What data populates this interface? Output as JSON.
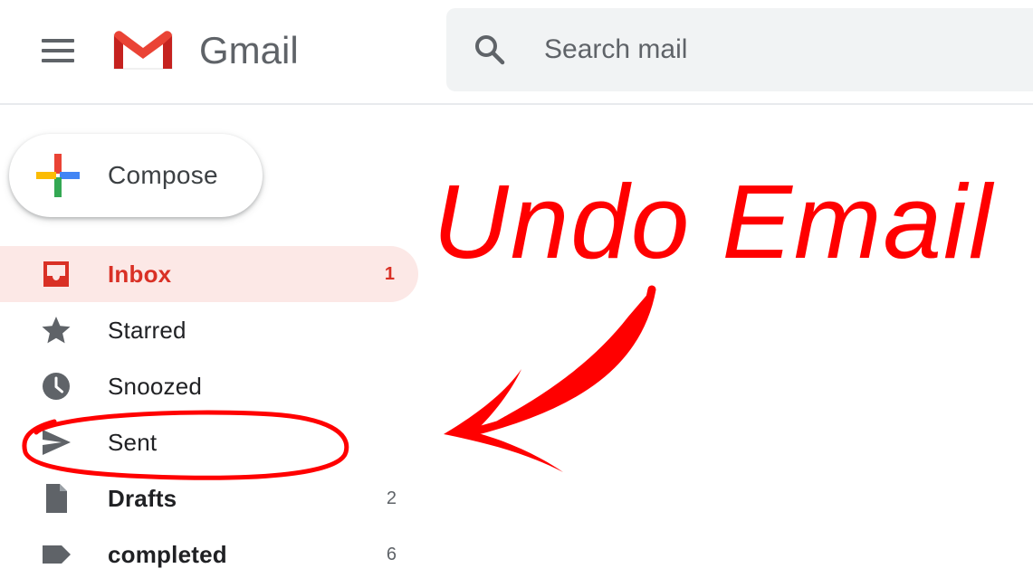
{
  "header": {
    "app_name": "Gmail",
    "menu_icon": "hamburger-menu-icon",
    "logo_icon": "gmail-m-logo-icon"
  },
  "search": {
    "placeholder": "Search mail",
    "value": "",
    "icon": "search-icon"
  },
  "compose": {
    "label": "Compose",
    "icon": "colorful-plus-icon"
  },
  "nav": {
    "items": [
      {
        "label": "Inbox",
        "count": "1",
        "icon": "inbox-icon",
        "active": true
      },
      {
        "label": "Starred",
        "count": "",
        "icon": "star-icon"
      },
      {
        "label": "Snoozed",
        "count": "",
        "icon": "clock-icon"
      },
      {
        "label": "Sent",
        "count": "",
        "icon": "send-icon"
      },
      {
        "label": "Drafts",
        "count": "2",
        "icon": "draft-document-icon"
      },
      {
        "label": "completed",
        "count": "6",
        "icon": "label-tag-icon"
      }
    ]
  },
  "annotation": {
    "title": "Undo Email",
    "color": "#ff0000"
  },
  "colors": {
    "active_red": "#d93025",
    "active_bg": "#fce8e6",
    "icon_gray": "#5f6368",
    "search_bg": "#f1f3f4",
    "google_blue": "#4285f4",
    "google_red": "#ea4335",
    "google_yellow": "#fbbc04",
    "google_green": "#34a853"
  }
}
